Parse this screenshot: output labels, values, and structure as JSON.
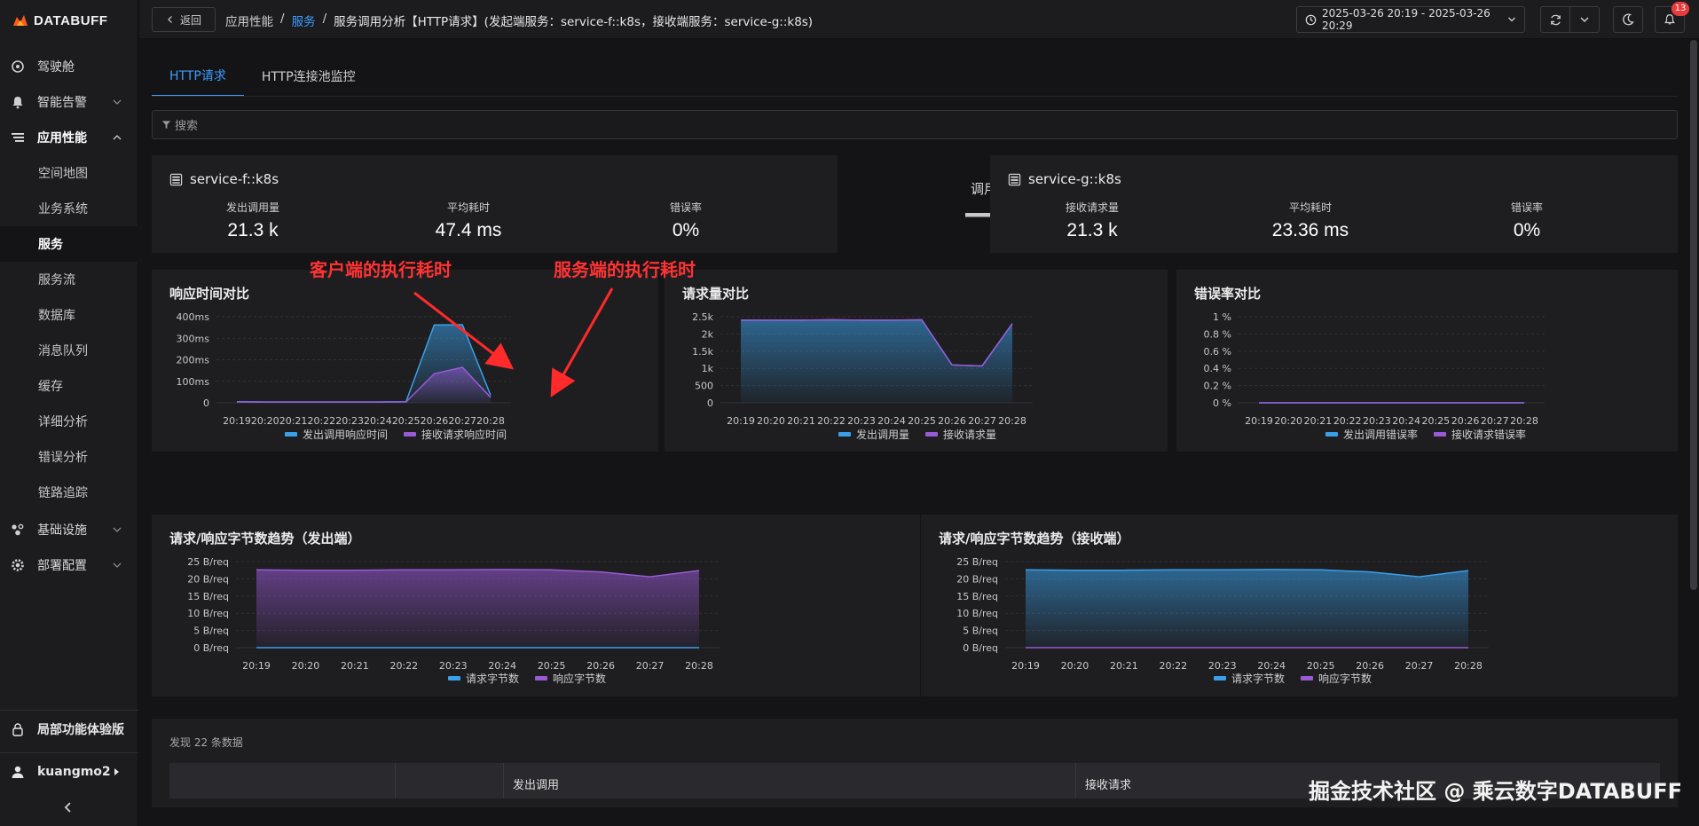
{
  "brand": {
    "name": "DATABUFF"
  },
  "sidebar": {
    "items": [
      {
        "label": "驾驶舱",
        "icon": "dashboard-icon"
      },
      {
        "label": "智能告警",
        "icon": "bell-icon"
      },
      {
        "label": "应用性能",
        "icon": "list-icon"
      }
    ],
    "sub_items": [
      "空间地图",
      "业务系统",
      "服务",
      "服务流",
      "数据库",
      "消息队列",
      "缓存",
      "详细分析",
      "错误分析",
      "链路追踪"
    ],
    "items_after": [
      {
        "label": "基础设施",
        "icon": "infra-icon"
      },
      {
        "label": "部署配置",
        "icon": "gear-icon"
      }
    ],
    "trial": "局部功能体验版",
    "user": "kuangmo2"
  },
  "topbar": {
    "back_label": "返回",
    "breadcrumb": {
      "root": "应用性能",
      "sep": "/",
      "link": "服务",
      "current": "服务调用分析【HTTP请求】(发起端服务：service-f::k8s，接收端服务：service-g::k8s)"
    },
    "time_range": "2025-03-26 20:19 - 2025-03-26 20:29",
    "notification_count": "13"
  },
  "tabs": [
    "HTTP请求",
    "HTTP连接池监控"
  ],
  "search": {
    "placeholder": "搜索"
  },
  "caller": {
    "name": "service-f::k8s",
    "metrics": [
      {
        "label": "发出调用量",
        "value": "21.3 k"
      },
      {
        "label": "平均耗时",
        "value": "47.4 ms"
      },
      {
        "label": "错误率",
        "value": "0%"
      }
    ]
  },
  "call_label": "调用",
  "callee": {
    "name": "service-g::k8s",
    "metrics": [
      {
        "label": "接收请求量",
        "value": "21.3 k"
      },
      {
        "label": "平均耗时",
        "value": "23.36 ms"
      },
      {
        "label": "错误率",
        "value": "0%"
      }
    ]
  },
  "annotations": {
    "client": "客户端的执行耗时",
    "server": "服务端的执行耗时"
  },
  "colors": {
    "blue": "#3aa0ea",
    "purple": "#9a5ad6",
    "accent": "#3d9bff"
  },
  "chart_data": [
    {
      "type": "area",
      "title": "响应时间对比",
      "x": [
        "20:19",
        "20:20",
        "20:21",
        "20:22",
        "20:23",
        "20:24",
        "20:25",
        "20:26",
        "20:27",
        "20:28"
      ],
      "yticks": [
        "0",
        "100ms",
        "200ms",
        "300ms",
        "400ms"
      ],
      "ylim": [
        0,
        400
      ],
      "series": [
        {
          "name": "发出调用响应时间",
          "values": [
            5,
            4,
            4,
            4,
            4,
            4,
            5,
            362,
            363,
            35
          ]
        },
        {
          "name": "接收请求响应时间",
          "values": [
            4,
            3,
            3,
            3,
            3,
            3,
            4,
            135,
            165,
            25
          ]
        }
      ]
    },
    {
      "type": "area",
      "title": "请求量对比",
      "x": [
        "20:19",
        "20:20",
        "20:21",
        "20:22",
        "20:23",
        "20:24",
        "20:25",
        "20:26",
        "20:27",
        "20:28"
      ],
      "yticks": [
        "0",
        "500",
        "1k",
        "1.5k",
        "2k",
        "2.5k"
      ],
      "ylim": [
        0,
        2500
      ],
      "series": [
        {
          "name": "发出调用量",
          "values": [
            2400,
            2400,
            2400,
            2410,
            2400,
            2400,
            2410,
            1100,
            1070,
            2300
          ]
        },
        {
          "name": "接收请求量",
          "values": [
            2400,
            2400,
            2400,
            2410,
            2400,
            2400,
            2410,
            1100,
            1070,
            2300
          ]
        }
      ]
    },
    {
      "type": "line",
      "title": "错误率对比",
      "x": [
        "20:19",
        "20:20",
        "20:21",
        "20:22",
        "20:23",
        "20:24",
        "20:25",
        "20:26",
        "20:27",
        "20:28"
      ],
      "yticks": [
        "0 %",
        "0.2 %",
        "0.4 %",
        "0.6 %",
        "0.8 %",
        "1 %"
      ],
      "ylim": [
        0,
        1
      ],
      "series": [
        {
          "name": "发出调用错误率",
          "values": [
            0,
            0,
            0,
            0,
            0,
            0,
            0,
            0,
            0,
            0
          ]
        },
        {
          "name": "接收请求错误率",
          "values": [
            0,
            0,
            0,
            0,
            0,
            0,
            0,
            0,
            0,
            0
          ]
        }
      ]
    },
    {
      "type": "area",
      "title": "请求/响应字节数趋势（发出端）",
      "x": [
        "20:19",
        "20:20",
        "20:21",
        "20:22",
        "20:23",
        "20:24",
        "20:25",
        "20:26",
        "20:27",
        "20:28"
      ],
      "yticks": [
        "0 B/req",
        "5 B/req",
        "10 B/req",
        "15 B/req",
        "20 B/req",
        "25 B/req"
      ],
      "ylim": [
        0,
        25
      ],
      "series": [
        {
          "name": "请求字节数",
          "values": [
            0,
            0,
            0,
            0,
            0,
            0,
            0,
            0,
            0,
            0
          ]
        },
        {
          "name": "响应字节数",
          "values": [
            22.6,
            22.5,
            22.5,
            22.6,
            22.6,
            22.7,
            22.6,
            22.0,
            20.6,
            22.4
          ]
        }
      ]
    },
    {
      "type": "area",
      "title": "请求/响应字节数趋势（接收端）",
      "x": [
        "20:19",
        "20:20",
        "20:21",
        "20:22",
        "20:23",
        "20:24",
        "20:25",
        "20:26",
        "20:27",
        "20:28"
      ],
      "yticks": [
        "0 B/req",
        "5 B/req",
        "10 B/req",
        "15 B/req",
        "20 B/req",
        "25 B/req"
      ],
      "ylim": [
        0,
        25
      ],
      "series": [
        {
          "name": "请求字节数",
          "values": [
            22.6,
            22.5,
            22.5,
            22.6,
            22.6,
            22.7,
            22.6,
            22.0,
            20.6,
            22.4
          ]
        },
        {
          "name": "响应字节数",
          "values": [
            0,
            0,
            0,
            0,
            0,
            0,
            0,
            0,
            0,
            0
          ]
        }
      ]
    }
  ],
  "table": {
    "found_text": "发现 22 条数据",
    "group_headers": [
      "发出调用",
      "接收请求"
    ]
  },
  "watermark": "掘金技术社区 @ 乘云数字DATABUFF"
}
